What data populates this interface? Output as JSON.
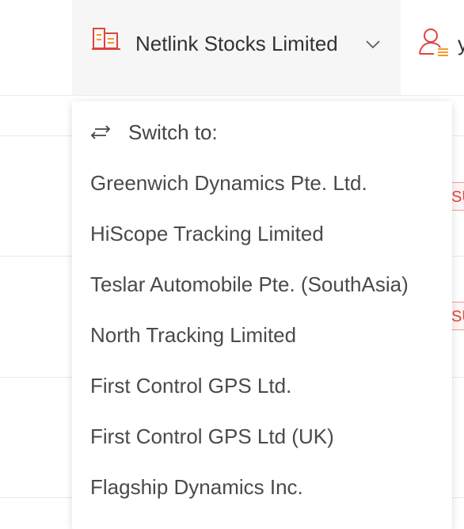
{
  "header": {
    "company_name": "Netlink Stocks Limited",
    "user_name_fragment": "y",
    "icons": {
      "company": "building-icon",
      "chevron": "chevron-down-icon",
      "user": "user-icon"
    }
  },
  "background": {
    "badge_text": "SU"
  },
  "dropdown": {
    "switch_label": "Switch to:",
    "switch_icon": "switch-arrows-icon",
    "items": [
      {
        "label": "Greenwich Dynamics Pte. Ltd."
      },
      {
        "label": "HiScope Tracking Limited"
      },
      {
        "label": "Teslar Automobile Pte. (SouthAsia)"
      },
      {
        "label": "North Tracking Limited"
      },
      {
        "label": "First Control GPS Ltd."
      },
      {
        "label": "First Control GPS Ltd (UK)"
      },
      {
        "label": "Flagship Dynamics Inc."
      }
    ]
  },
  "colors": {
    "accent_red": "#e0443f",
    "accent_orange": "#f39a2c",
    "switcher_bg": "#f6f6f6"
  }
}
